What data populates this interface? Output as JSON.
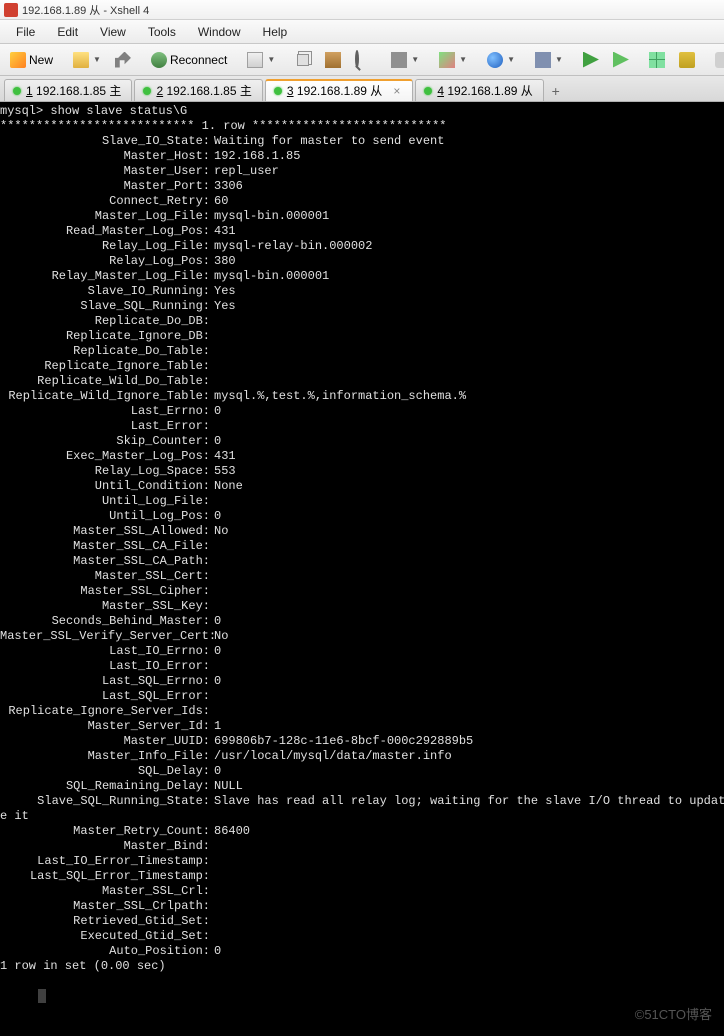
{
  "titlebar": "192.168.1.89 从 - Xshell 4",
  "menu": [
    "File",
    "Edit",
    "View",
    "Tools",
    "Window",
    "Help"
  ],
  "toolbar": {
    "new": "New",
    "reconnect": "Reconnect"
  },
  "tabs": [
    {
      "num": "1",
      "label": "192.168.1.85 主",
      "active": false,
      "closable": false
    },
    {
      "num": "2",
      "label": "192.168.1.85 主",
      "active": false,
      "closable": false
    },
    {
      "num": "3",
      "label": "192.168.1.89 从",
      "active": true,
      "closable": true
    },
    {
      "num": "4",
      "label": "192.168.1.89 从",
      "active": false,
      "closable": false
    }
  ],
  "terminal": {
    "prompt": "mysql> show slave status\\G",
    "divider": "*************************** 1. row ***************************",
    "fields": [
      {
        "k": "Slave_IO_State",
        "v": "Waiting for master to send event"
      },
      {
        "k": "Master_Host",
        "v": "192.168.1.85"
      },
      {
        "k": "Master_User",
        "v": "repl_user"
      },
      {
        "k": "Master_Port",
        "v": "3306"
      },
      {
        "k": "Connect_Retry",
        "v": "60"
      },
      {
        "k": "Master_Log_File",
        "v": "mysql-bin.000001"
      },
      {
        "k": "Read_Master_Log_Pos",
        "v": "431"
      },
      {
        "k": "Relay_Log_File",
        "v": "mysql-relay-bin.000002"
      },
      {
        "k": "Relay_Log_Pos",
        "v": "380"
      },
      {
        "k": "Relay_Master_Log_File",
        "v": "mysql-bin.000001"
      },
      {
        "k": "Slave_IO_Running",
        "v": "Yes"
      },
      {
        "k": "Slave_SQL_Running",
        "v": "Yes"
      },
      {
        "k": "Replicate_Do_DB",
        "v": ""
      },
      {
        "k": "Replicate_Ignore_DB",
        "v": ""
      },
      {
        "k": "Replicate_Do_Table",
        "v": ""
      },
      {
        "k": "Replicate_Ignore_Table",
        "v": ""
      },
      {
        "k": "Replicate_Wild_Do_Table",
        "v": ""
      },
      {
        "k": "Replicate_Wild_Ignore_Table",
        "v": "mysql.%,test.%,information_schema.%"
      },
      {
        "k": "Last_Errno",
        "v": "0"
      },
      {
        "k": "Last_Error",
        "v": ""
      },
      {
        "k": "Skip_Counter",
        "v": "0"
      },
      {
        "k": "Exec_Master_Log_Pos",
        "v": "431"
      },
      {
        "k": "Relay_Log_Space",
        "v": "553"
      },
      {
        "k": "Until_Condition",
        "v": "None"
      },
      {
        "k": "Until_Log_File",
        "v": ""
      },
      {
        "k": "Until_Log_Pos",
        "v": "0"
      },
      {
        "k": "Master_SSL_Allowed",
        "v": "No"
      },
      {
        "k": "Master_SSL_CA_File",
        "v": ""
      },
      {
        "k": "Master_SSL_CA_Path",
        "v": ""
      },
      {
        "k": "Master_SSL_Cert",
        "v": ""
      },
      {
        "k": "Master_SSL_Cipher",
        "v": ""
      },
      {
        "k": "Master_SSL_Key",
        "v": ""
      },
      {
        "k": "Seconds_Behind_Master",
        "v": "0"
      },
      {
        "k": "Master_SSL_Verify_Server_Cert",
        "v": "No"
      },
      {
        "k": "Last_IO_Errno",
        "v": "0"
      },
      {
        "k": "Last_IO_Error",
        "v": ""
      },
      {
        "k": "Last_SQL_Errno",
        "v": "0"
      },
      {
        "k": "Last_SQL_Error",
        "v": ""
      },
      {
        "k": "Replicate_Ignore_Server_Ids",
        "v": ""
      },
      {
        "k": "Master_Server_Id",
        "v": "1"
      },
      {
        "k": "Master_UUID",
        "v": "699806b7-128c-11e6-8bcf-000c292889b5"
      },
      {
        "k": "Master_Info_File",
        "v": "/usr/local/mysql/data/master.info"
      },
      {
        "k": "SQL_Delay",
        "v": "0"
      },
      {
        "k": "SQL_Remaining_Delay",
        "v": "NULL"
      },
      {
        "k": "Slave_SQL_Running_State",
        "v": "Slave has read all relay log; waiting for the slave I/O thread to updat"
      },
      {
        "k": "Master_Retry_Count",
        "v": "86400"
      },
      {
        "k": "Master_Bind",
        "v": ""
      },
      {
        "k": "Last_IO_Error_Timestamp",
        "v": ""
      },
      {
        "k": "Last_SQL_Error_Timestamp",
        "v": ""
      },
      {
        "k": "Master_SSL_Crl",
        "v": ""
      },
      {
        "k": "Master_SSL_Crlpath",
        "v": ""
      },
      {
        "k": "Retrieved_Gtid_Set",
        "v": ""
      },
      {
        "k": "Executed_Gtid_Set",
        "v": ""
      },
      {
        "k": "Auto_Position",
        "v": "0"
      }
    ],
    "wrap_line": "e it",
    "footer": "1 row in set (0.00 sec)"
  },
  "watermark": "©51CTO博客"
}
